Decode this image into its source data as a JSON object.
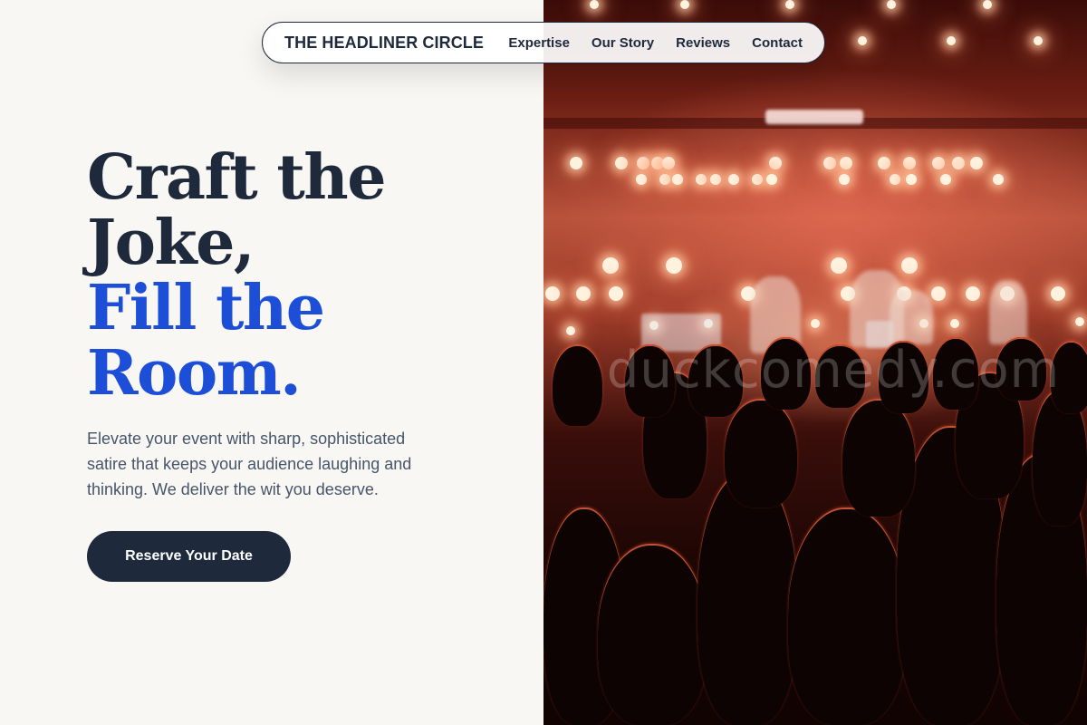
{
  "nav": {
    "brand": "THE HEADLINER CIRCLE",
    "links": [
      "Expertise",
      "Our Story",
      "Reviews",
      "Contact"
    ]
  },
  "hero": {
    "title_lines": [
      "Craft the",
      "Joke,"
    ],
    "title_accent_lines": [
      "Fill the",
      "Room."
    ],
    "description": "Elevate your event with sharp, sophisticated satire that keeps your audience laughing and thinking. We deliver the wit you deserve.",
    "cta_label": "Reserve Your Date"
  },
  "image": {
    "watermark": "duckcomedy.com",
    "subject": "concert crowd silhouettes facing a stage lit by warm spotlights"
  },
  "colors": {
    "background": "#f8f7f4",
    "text_dark": "#1e293b",
    "accent_blue": "#1d4ed8",
    "muted_text": "#475569",
    "button_bg": "#1e293b"
  }
}
